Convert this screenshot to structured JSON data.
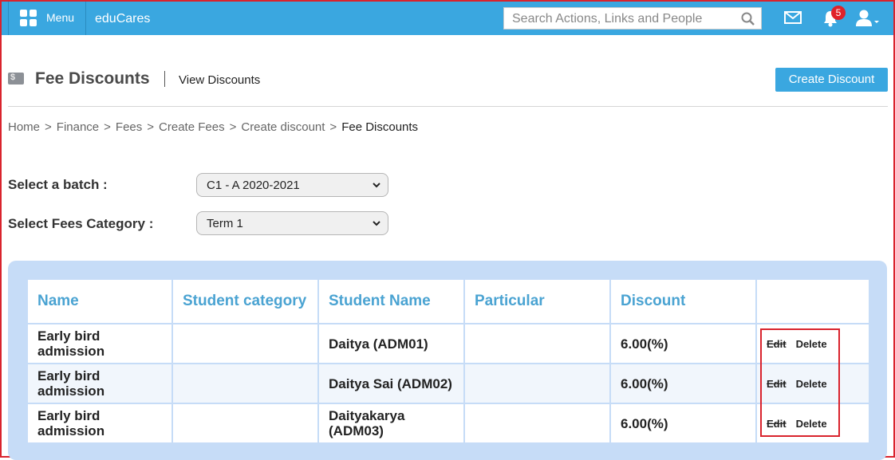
{
  "header": {
    "menu_label": "Menu",
    "brand": "eduCares",
    "search_placeholder": "Search Actions, Links and People",
    "notification_count": "5",
    "icons": [
      "grid-icon",
      "search-icon",
      "mail-icon",
      "bell-icon",
      "user-icon"
    ]
  },
  "page": {
    "title": "Fee Discounts",
    "subtitle": "View Discounts",
    "create_button": "Create Discount"
  },
  "breadcrumb": [
    "Home",
    "Finance",
    "Fees",
    "Create Fees",
    "Create discount",
    "Fee Discounts"
  ],
  "breadcrumb_separator": ">",
  "form": {
    "batch_label": "Select a batch :",
    "batch_value": "C1 - A 2020-2021",
    "category_label": "Select Fees Category :",
    "category_value": "Term 1"
  },
  "table": {
    "headers": [
      "Name",
      "Student category",
      "Student Name",
      "Particular",
      "Discount",
      ""
    ],
    "rows": [
      {
        "name": "Early bird admission",
        "category": "",
        "student": "Daitya (ADM01)",
        "particular": "",
        "discount": "6.00(%)",
        "edit": "Edit",
        "delete": "Delete"
      },
      {
        "name": "Early bird admission",
        "category": "",
        "student": "Daitya Sai (ADM02)",
        "particular": "",
        "discount": "6.00(%)",
        "edit": "Edit",
        "delete": "Delete"
      },
      {
        "name": "Early bird admission",
        "category": "",
        "student": "Daityakarya (ADM03)",
        "particular": "",
        "discount": "6.00(%)",
        "edit": "Edit",
        "delete": "Delete"
      }
    ]
  },
  "colors": {
    "header_bg": "#3aa7e0",
    "highlight": "#d9232d",
    "panel_bg": "#c6dcf7",
    "table_header_text": "#4aa3d2"
  }
}
